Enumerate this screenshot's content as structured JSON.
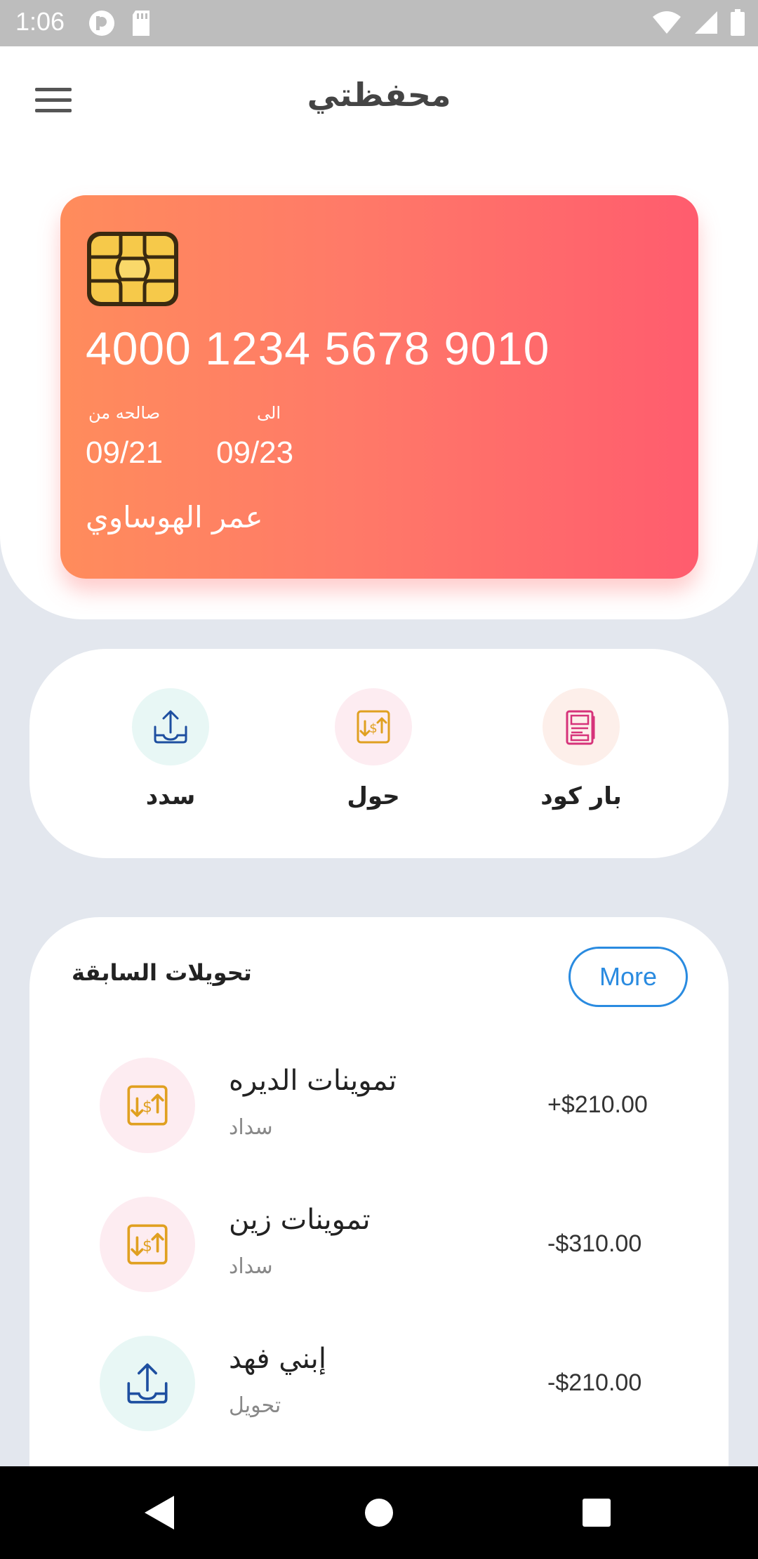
{
  "status_bar": {
    "time": "1:06"
  },
  "header": {
    "title": "محفظتي"
  },
  "card": {
    "number": "4000 1234 5678 9010",
    "valid_from_label": "صالحه من",
    "valid_to_label": "الى",
    "valid_from": "09/21",
    "valid_to": "09/23",
    "holder": "عمر الهوساوي"
  },
  "actions": [
    {
      "label": "سدد",
      "icon": "upload-tray-icon",
      "bg": "#e8f7f5"
    },
    {
      "label": "حول",
      "icon": "money-transfer-icon",
      "bg": "#fdecf1"
    },
    {
      "label": "بار كود",
      "icon": "barcode-receipt-icon",
      "bg": "#fdefea"
    }
  ],
  "history": {
    "title": "تحويلات السابقة",
    "more_label": "More",
    "transactions": [
      {
        "title": "تموينات الديره",
        "subtitle": "سداد",
        "amount": "+$210.00",
        "icon": "money-transfer-icon"
      },
      {
        "title": "تموينات زين",
        "subtitle": "سداد",
        "amount": "-$310.00",
        "icon": "money-transfer-icon"
      },
      {
        "title": "إبني فهد",
        "subtitle": "تحويل",
        "amount": "-$210.00",
        "icon": "upload-tray-icon"
      }
    ]
  },
  "colors": {
    "card_gradient_start": "#ff8c5c",
    "card_gradient_end": "#ff5c6e",
    "accent_blue": "#2a8be0",
    "icon_gold": "#e0a020"
  }
}
